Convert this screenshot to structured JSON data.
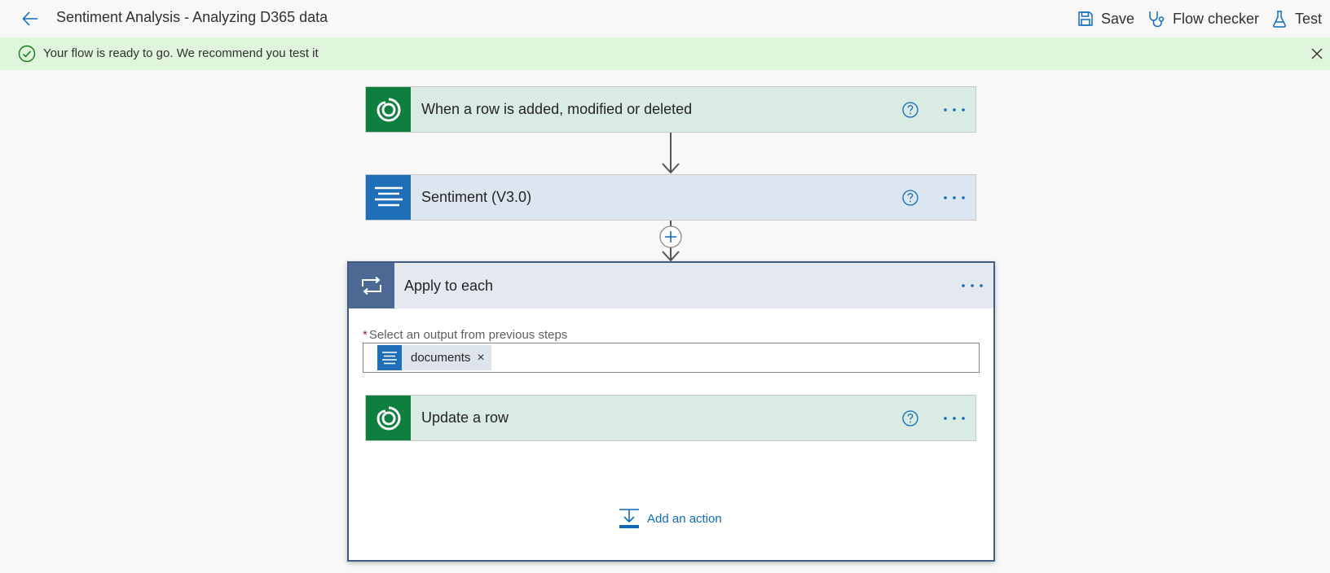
{
  "header": {
    "flow_title": "Sentiment Analysis - Analyzing D365 data",
    "back_icon": "back-arrow-icon",
    "commands": {
      "save_label": "Save",
      "flow_checker_label": "Flow checker",
      "test_label": "Test"
    }
  },
  "banner": {
    "message": "Your flow is ready to go. We recommend you test it",
    "status": "success",
    "color": "#dff6dd"
  },
  "steps": {
    "trigger": {
      "title": "When a row is added, modified or deleted",
      "icon": "dataverse-icon",
      "color": "#0f7f3f"
    },
    "sentiment": {
      "title": "Sentiment (V3.0)",
      "icon": "text-analytics-icon",
      "color": "#1e6fb8"
    },
    "apply_to_each": {
      "title": "Apply to each",
      "icon": "loop-icon",
      "color": "#4d6892",
      "field_required_marker": "*",
      "field_label": "Select an output from previous steps",
      "token_label": "documents",
      "token_remove": "×",
      "inner_step": {
        "title": "Update a row",
        "icon": "dataverse-icon",
        "color": "#0f7f3f"
      },
      "add_action_label": "Add an action"
    }
  },
  "colors": {
    "accent": "#0f6cbd",
    "success": "#107c10"
  }
}
